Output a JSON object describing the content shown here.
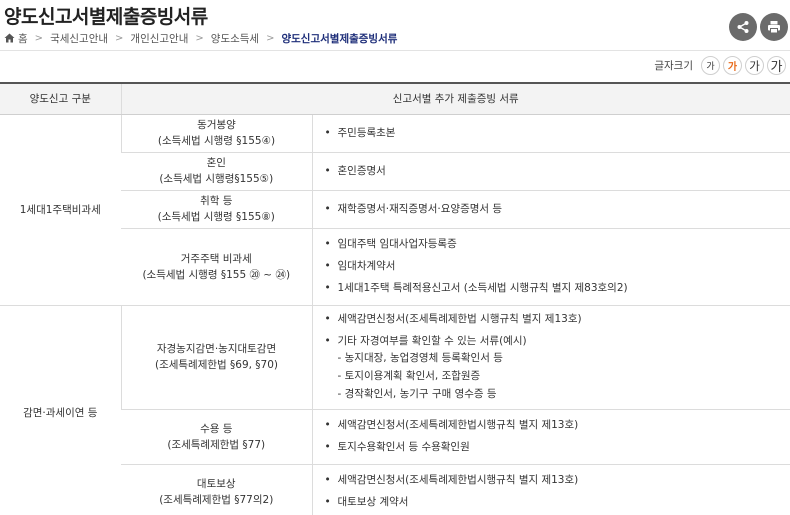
{
  "page": {
    "title": "양도신고서별제출증빙서류",
    "share_icon": "share-icon",
    "print_icon": "print-icon"
  },
  "breadcrumb": {
    "home": "홈",
    "items": [
      "국세신고안내",
      "개인신고안내",
      "양도소득세"
    ],
    "current": "양도신고서별제출증빙서류"
  },
  "font_size": {
    "label": "글자크기",
    "buttons": [
      "가",
      "가",
      "가",
      "가"
    ],
    "active_index": 1,
    "active_color": "#e86a1a"
  },
  "table": {
    "headers": [
      "양도신고 구분",
      "신고서별 추가 제출증빙 서류"
    ],
    "groups": [
      {
        "category": "1세대1주택비과세",
        "rows": [
          {
            "name": "동거봉양",
            "law": "(소득세법 시행령 §155④)",
            "docs": [
              "주민등록초본"
            ]
          },
          {
            "name": "혼인",
            "law": "(소득세법 시행령§155⑤)",
            "docs": [
              "혼인증명서"
            ]
          },
          {
            "name": "취학 등",
            "law": "(소득세법 시행령 §155⑧)",
            "docs": [
              "재학증명서·재직증명서·요양증명서 등"
            ]
          },
          {
            "name": "거주주택 비과세",
            "law": "(소득세법 시행령 §155 ⑳ ~ ㉔)",
            "docs": [
              "임대주택 임대사업자등록증",
              "임대차계약서",
              "1세대1주택 특례적용신고서 (소득세법 시행규칙 별지 제83호의2)"
            ]
          }
        ]
      },
      {
        "category": "감면·과세이연 등",
        "rows": [
          {
            "name": "자경농지감면·농지대토감면",
            "law": "(조세특례제한법 §69, §70)",
            "docs": [
              "세액감면신청서(조세특례제한법 시행규칙 별지 제13호)",
              "기타 자경여부를 확인할 수 있는 서류(예시)"
            ],
            "subs": [
              "- 농지대장, 농업경영체 등록확인서 등",
              "- 토지이용계획 확인서, 조합원증",
              "- 경작확인서, 농기구 구매 영수증 등"
            ]
          },
          {
            "name": "수용 등",
            "law": "(조세특례제한법 §77)",
            "docs": [
              "세액감면신청서(조세특례제한법시행규칙 별지 제13호)",
              "토지수용확인서 등 수용확인원"
            ]
          },
          {
            "name": "대토보상",
            "law": "(조세특례제한법 §77의2)",
            "docs": [
              "세액감면신청서(조세특례제한법시행규칙 별지 제13호)",
              "대토보상 계약서"
            ]
          }
        ]
      }
    ]
  }
}
